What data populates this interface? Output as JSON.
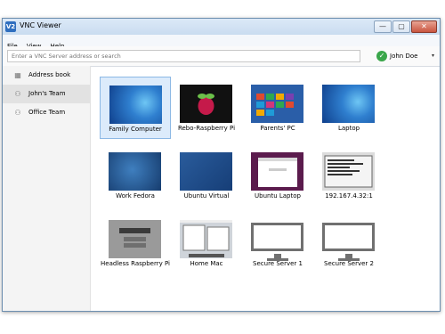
{
  "window": {
    "title": "VNC Viewer",
    "icon_text": "V2",
    "buttons": {
      "minimize": "—",
      "maximize": "▢",
      "close": "✕"
    }
  },
  "menu": [
    "File",
    "View",
    "Help"
  ],
  "address": {
    "placeholder": "Enter a VNC Server address or search",
    "value": ""
  },
  "user": {
    "name": "John Doe",
    "status_glyph": "✓",
    "status_color": "#3aa64a",
    "caret": "▾"
  },
  "sidebar": {
    "items": [
      {
        "label": "Address book",
        "icon": "grid-icon",
        "glyph": "▦",
        "selected": false
      },
      {
        "label": "John's Team",
        "icon": "team-icon",
        "glyph": "⚇",
        "selected": true
      },
      {
        "label": "Office Team",
        "icon": "team-icon",
        "glyph": "⚇",
        "selected": false
      }
    ]
  },
  "computers": [
    {
      "label": "Family Computer",
      "thumb": "windows-7-desktop",
      "selected": true
    },
    {
      "label": "Rebo-Raspberry Pi",
      "thumb": "raspberry-pi-desktop",
      "selected": false
    },
    {
      "label": "Parents' PC",
      "thumb": "windows-8-start-screen",
      "selected": false
    },
    {
      "label": "Laptop",
      "thumb": "windows-7-desktop",
      "selected": false
    },
    {
      "label": "Work Fedora",
      "thumb": "fedora-desktop",
      "selected": false
    },
    {
      "label": "Ubuntu Virtual",
      "thumb": "ubuntu-desktop",
      "selected": false
    },
    {
      "label": "Ubuntu Laptop",
      "thumb": "ubuntu-browser-desktop",
      "selected": false
    },
    {
      "label": "192.167.4.32:1",
      "thumb": "terminal-desktop",
      "selected": false
    },
    {
      "label": "Headless Raspberry Pi",
      "thumb": "minecraft-desktop",
      "selected": false
    },
    {
      "label": "Home Mac",
      "thumb": "mac-desktop",
      "selected": false
    },
    {
      "label": "Secure Server 1",
      "thumb": "monitor-icon",
      "selected": false
    },
    {
      "label": "Secure Server 2",
      "thumb": "monitor-icon",
      "selected": false
    }
  ]
}
